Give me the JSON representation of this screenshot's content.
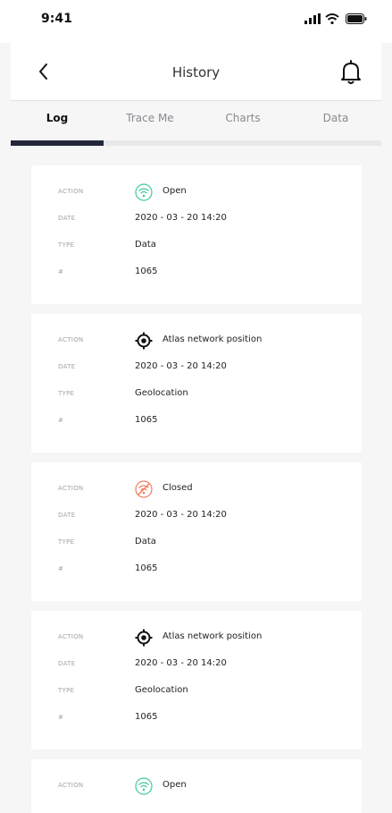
{
  "status_bar": {
    "time": "9:41"
  },
  "header": {
    "title": "History"
  },
  "tabs": [
    {
      "label": "Log",
      "active": true
    },
    {
      "label": "Trace Me",
      "active": false
    },
    {
      "label": "Charts",
      "active": false
    },
    {
      "label": "Data",
      "active": false
    }
  ],
  "labels": {
    "action": "ACTION",
    "date": "DATE",
    "type": "TYPE",
    "number": "#"
  },
  "entries": [
    {
      "icon": "wifi-open-icon",
      "action": "Open",
      "date": "2020 - 03 - 20   14:20",
      "type": "Data",
      "number": "1065"
    },
    {
      "icon": "target-icon",
      "action": "Atlas network position",
      "date": "2020 - 03 - 20   14:20",
      "type": "Geolocation",
      "number": "1065"
    },
    {
      "icon": "wifi-closed-icon",
      "action": "Closed",
      "date": "2020 - 03 - 20   14:20",
      "type": "Data",
      "number": "1065"
    },
    {
      "icon": "target-icon",
      "action": "Atlas network position",
      "date": "2020 - 03 - 20   14:20",
      "type": "Geolocation",
      "number": "1065"
    },
    {
      "icon": "wifi-open-icon",
      "action": "Open",
      "date": "",
      "type": "",
      "number": ""
    }
  ],
  "colors": {
    "open": "#3cc9a0",
    "closed": "#f07a5f",
    "target": "#111111",
    "indicator": "#22263a"
  }
}
